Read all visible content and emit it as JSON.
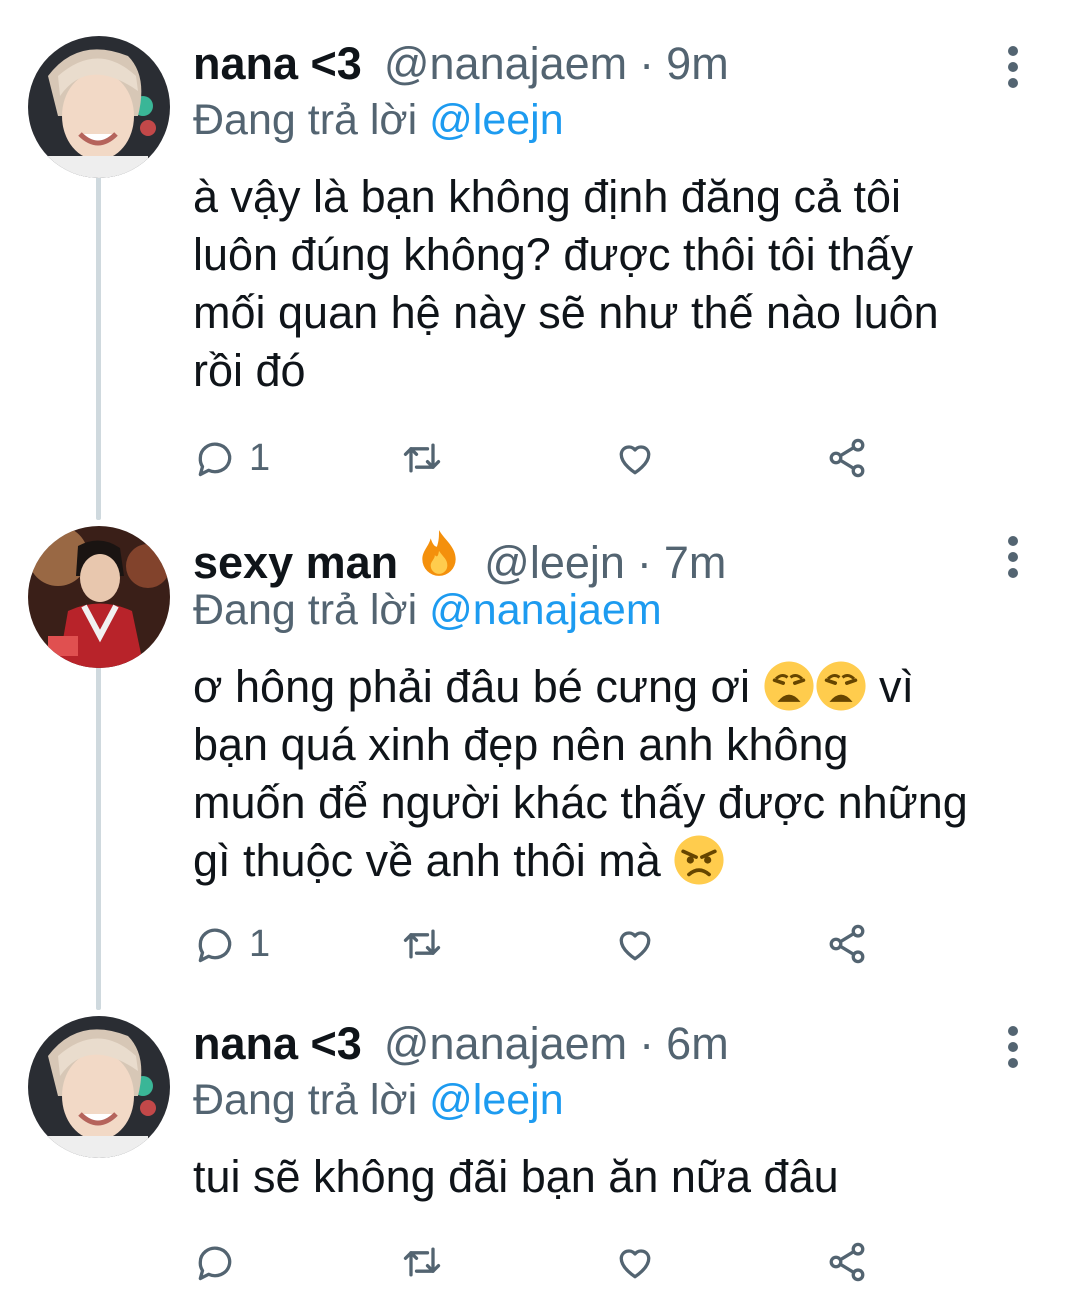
{
  "tweets": [
    {
      "name": "nana <3",
      "handle": "@nanajaem",
      "separator": "·",
      "time": "9m",
      "reply_prefix": "Đang trả lời",
      "reply_mention": "@leejn",
      "lines": [
        "à vậy là bạn không định đăng cả tôi",
        "luôn đúng không? được thôi tôi thấy",
        "mối quan hệ này sẽ như thế nào luôn",
        "rồi đó"
      ],
      "reply_count": "1"
    },
    {
      "name": "sexy man",
      "name_emoji": "fire-emoji",
      "handle": "@leejn",
      "separator": "·",
      "time": "7m",
      "reply_prefix": "Đang trả lời",
      "reply_mention": "@nanajaem",
      "lines": [
        {
          "a": "ơ hông phải đâu bé cưng ơi ",
          "emojis": [
            "weary-face",
            "weary-face"
          ],
          "b": " vì"
        },
        "bạn quá xinh đẹp nên anh không",
        "muốn để người khác thấy được những",
        {
          "a": "gì thuộc về anh thôi mà ",
          "emojis": [
            "angry-face"
          ]
        }
      ],
      "reply_count": "1"
    },
    {
      "name": "nana <3",
      "handle": "@nanajaem",
      "separator": "·",
      "time": "6m",
      "reply_prefix": "Đang trả lời",
      "reply_mention": "@leejn",
      "lines": [
        "tui sẽ không đãi bạn ăn nữa đâu"
      ],
      "reply_count": ""
    }
  ],
  "colors": {
    "text": "#0f1419",
    "secondary": "#536471",
    "mention": "#1d9bf0",
    "thread_line": "#cfd9de"
  },
  "icons": [
    "reply-icon",
    "retweet-icon",
    "like-icon",
    "share-icon",
    "more-icon"
  ]
}
